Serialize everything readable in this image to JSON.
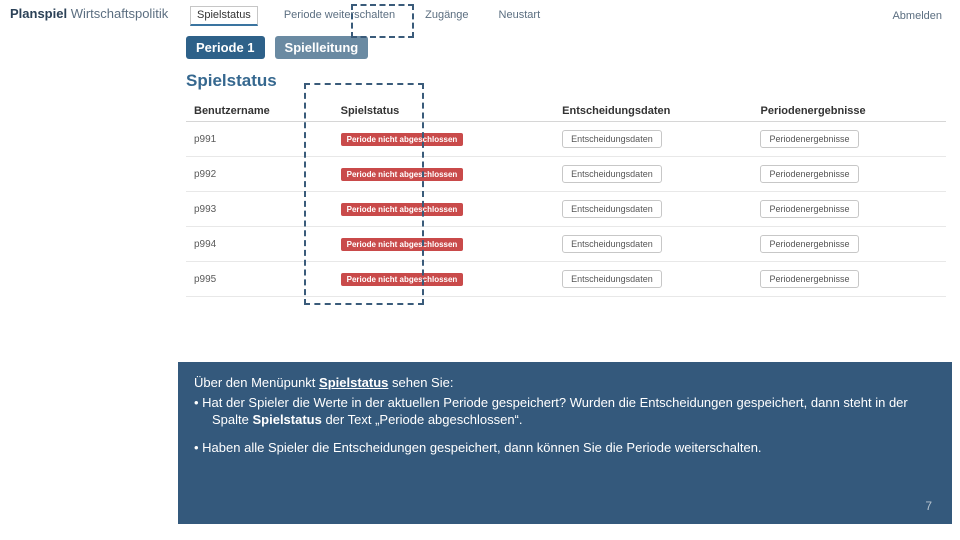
{
  "nav": {
    "brand_main": "Planspiel",
    "brand_sub": " Wirtschaftspolitik",
    "items": [
      "Spielstatus",
      "Periode weiterschalten",
      "Zugänge",
      "Neustart"
    ],
    "logout": "Abmelden"
  },
  "pills": {
    "period": "Periode 1",
    "role": "Spielleitung"
  },
  "page_title": "Spielstatus",
  "table": {
    "headers": [
      "Benutzername",
      "Spielstatus",
      "Entscheidungsdaten",
      "Periodenergebnisse"
    ],
    "rows": [
      {
        "user": "p991",
        "status": "Periode nicht abgeschlossen",
        "btn1": "Entscheidungsdaten",
        "btn2": "Periodenergebnisse"
      },
      {
        "user": "p992",
        "status": "Periode nicht abgeschlossen",
        "btn1": "Entscheidungsdaten",
        "btn2": "Periodenergebnisse"
      },
      {
        "user": "p993",
        "status": "Periode nicht abgeschlossen",
        "btn1": "Entscheidungsdaten",
        "btn2": "Periodenergebnisse"
      },
      {
        "user": "p994",
        "status": "Periode nicht abgeschlossen",
        "btn1": "Entscheidungsdaten",
        "btn2": "Periodenergebnisse"
      },
      {
        "user": "p995",
        "status": "Periode nicht abgeschlossen",
        "btn1": "Entscheidungsdaten",
        "btn2": "Periodenergebnisse"
      }
    ]
  },
  "footer": {
    "lead_a": "Über den Menüpunkt ",
    "lead_u": "Spielstatus",
    "lead_b": " sehen Sie:",
    "bullet1_a": "Hat der Spieler die Werte in der aktuellen Periode gespeichert? Wurden die Entscheidungen gespeichert, dann steht in der Spalte ",
    "bullet1_b": "Spielstatus",
    "bullet1_c": " der Text „Periode abgeschlossen“.",
    "bullet2": "Haben alle Spieler die Entscheidungen gespeichert, dann können Sie die Periode weiterschalten.",
    "pagenum": "7"
  }
}
